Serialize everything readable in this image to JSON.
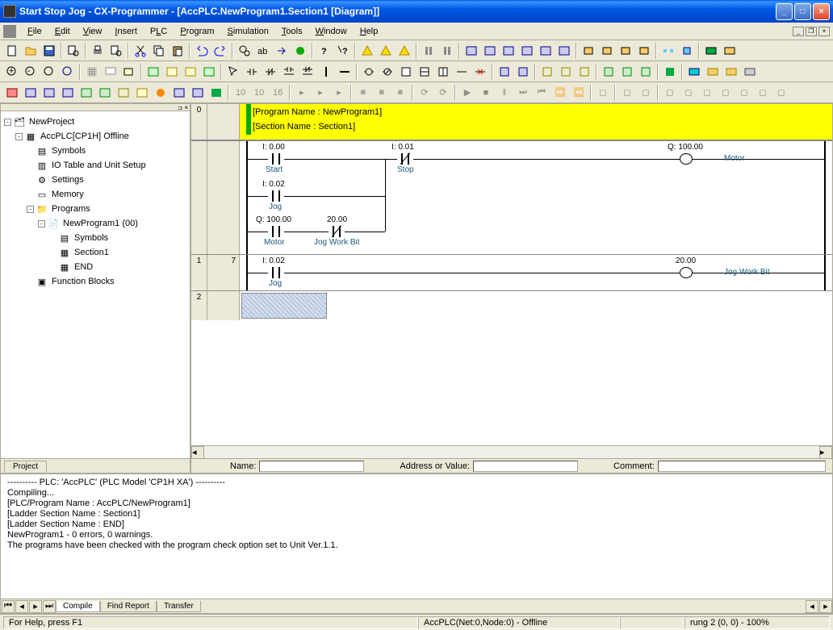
{
  "title": "Start Stop Jog - CX-Programmer - [AccPLC.NewProgram1.Section1 [Diagram]]",
  "menus": [
    "File",
    "Edit",
    "View",
    "Insert",
    "PLC",
    "Program",
    "Simulation",
    "Tools",
    "Window",
    "Help"
  ],
  "tree": {
    "root": "NewProject",
    "plc": "AccPLC[CP1H] Offline",
    "items": [
      "Symbols",
      "IO Table and Unit Setup",
      "Settings",
      "Memory",
      "Programs"
    ],
    "program": "NewProgram1 (00)",
    "prog_items": [
      "Symbols",
      "Section1",
      "END"
    ],
    "fb": "Function Blocks"
  },
  "sidetab": "Project",
  "rung_header": {
    "prog": "[Program Name : NewProgram1]",
    "sect": "[Section Name : Section1]"
  },
  "rung_nums": [
    "0",
    "1",
    "2"
  ],
  "rung_steps": [
    "",
    "7",
    ""
  ],
  "contacts": {
    "start": {
      "addr": "I: 0.00",
      "name": "Start"
    },
    "stop": {
      "addr": "I: 0.01",
      "name": "Stop"
    },
    "jog1": {
      "addr": "I: 0.02",
      "name": "Jog"
    },
    "motor_aux": {
      "addr": "Q: 100.00",
      "name": "Motor"
    },
    "jwb_nc": {
      "addr": "20.00",
      "name": "Jog Work Bit"
    },
    "jog2": {
      "addr": "I: 0.02",
      "name": "Jog"
    }
  },
  "coils": {
    "motor": {
      "addr": "Q: 100.00",
      "name": "Motor"
    },
    "jwb": {
      "addr": "20.00",
      "name": "Jog Work Bit"
    }
  },
  "info": {
    "name_lbl": "Name:",
    "addr_lbl": "Address or Value:",
    "comment_lbl": "Comment:"
  },
  "output": {
    "lines": [
      "---------- PLC: 'AccPLC' (PLC Model 'CP1H XA') ----------",
      "Compiling...",
      "[PLC/Program Name : AccPLC/NewProgram1]",
      "[Ladder Section Name : Section1]",
      "[Ladder Section Name : END]",
      "",
      "NewProgram1 - 0 errors, 0 warnings.",
      "The programs have been checked with the program check option set to Unit Ver.1.1."
    ],
    "tabs": [
      "Compile",
      "Find Report",
      "Transfer"
    ]
  },
  "status": {
    "help": "For Help, press F1",
    "conn": "AccPLC(Net:0,Node:0) - Offline",
    "rung": "rung 2 (0, 0)  - 100%"
  }
}
